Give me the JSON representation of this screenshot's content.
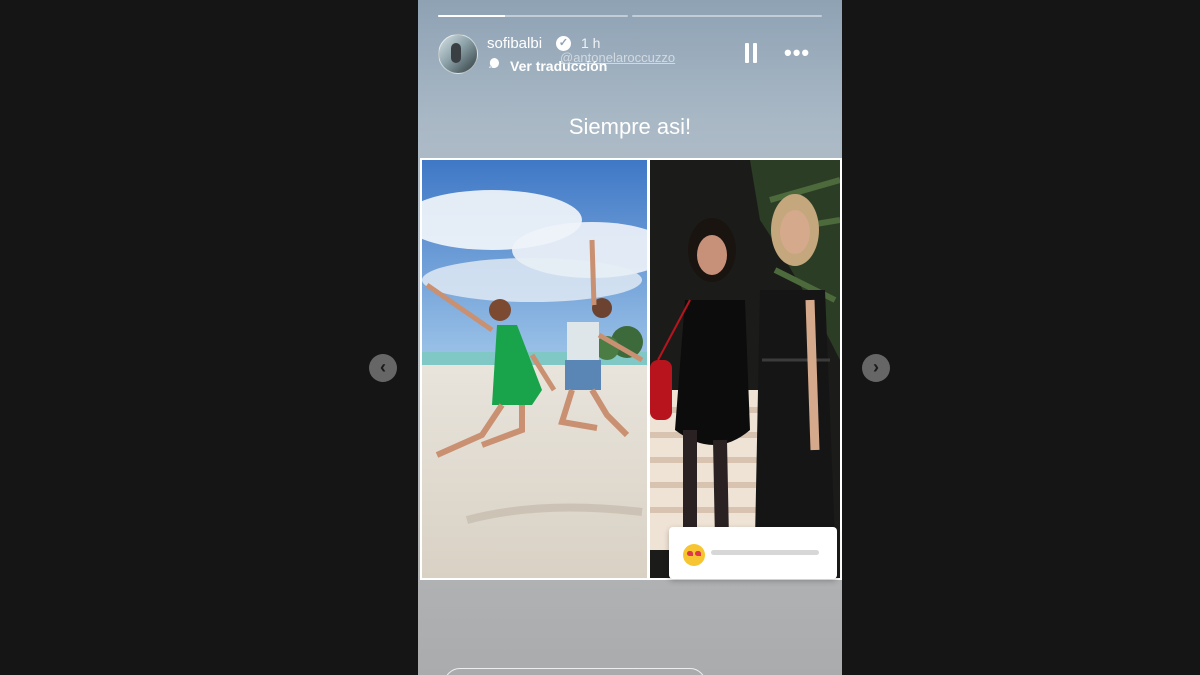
{
  "story": {
    "progress": [
      0.35,
      0.0
    ],
    "username": "sofibalbi",
    "verified_glyph": "✓",
    "time_ago": "1 h",
    "mention": "@antonelaroccuzzo",
    "translate_label": "Ver traducción",
    "more_label": "•••",
    "caption": "Siempre asi!",
    "photos": [
      {
        "name": "beach-jump-photo"
      },
      {
        "name": "party-photo"
      }
    ],
    "reaction_emoji": "heart-eyes-emoji"
  },
  "nav": {
    "prev_glyph": "‹",
    "next_glyph": "›"
  },
  "colors": {
    "background": "#151515",
    "story_top": "#8ea2b4",
    "story_bottom": "#a9abad"
  }
}
